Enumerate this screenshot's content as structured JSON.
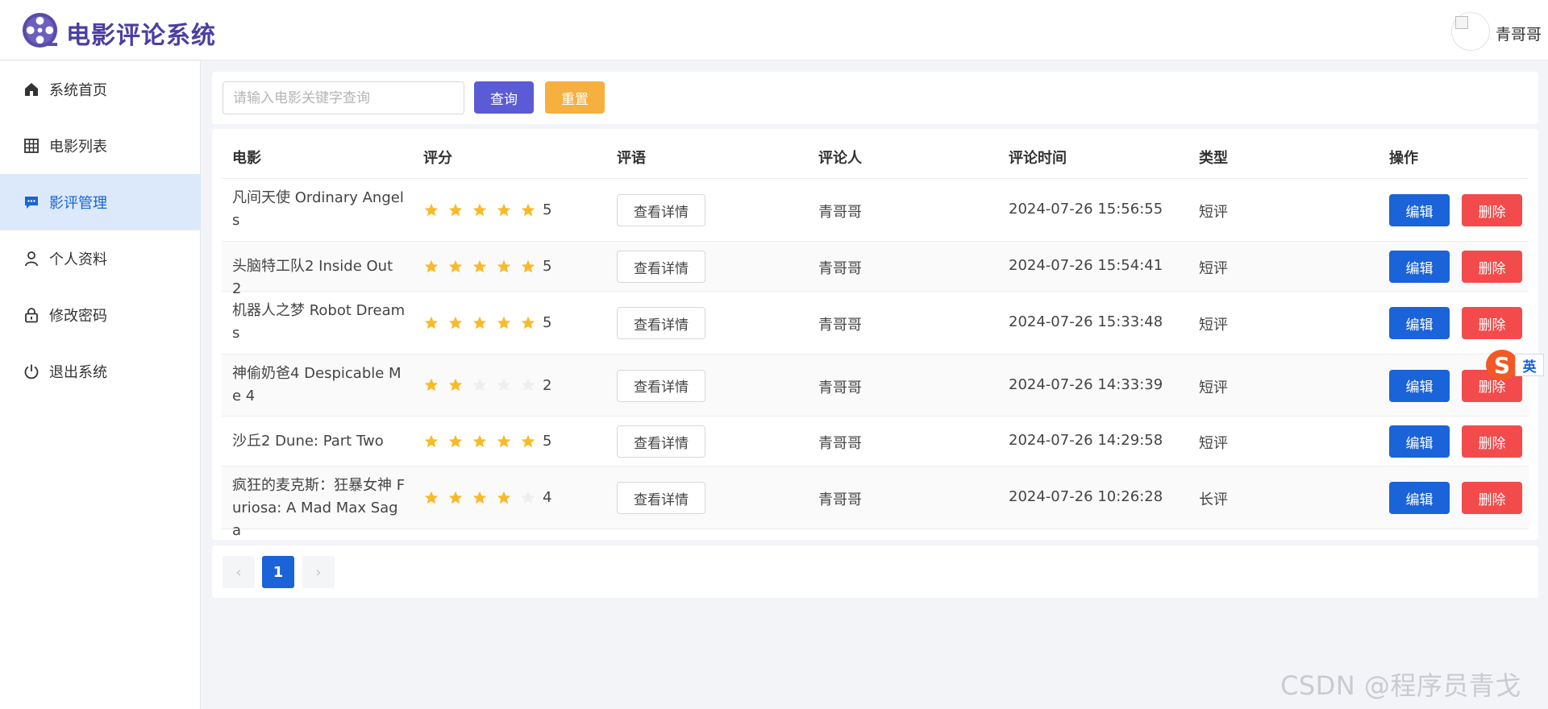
{
  "app": {
    "title": "电影评论系统",
    "user": "青哥哥"
  },
  "sidebar": {
    "items": [
      {
        "label": "系统首页",
        "icon": "home-icon",
        "active": false
      },
      {
        "label": "电影列表",
        "icon": "grid-icon",
        "active": false
      },
      {
        "label": "影评管理",
        "icon": "comment-icon",
        "active": true
      },
      {
        "label": "个人资料",
        "icon": "user-icon",
        "active": false
      },
      {
        "label": "修改密码",
        "icon": "lock-icon",
        "active": false
      },
      {
        "label": "退出系统",
        "icon": "power-icon",
        "active": false
      }
    ]
  },
  "search": {
    "placeholder": "请输入电影关键字查询",
    "value": "",
    "query_label": "查询",
    "reset_label": "重置"
  },
  "table": {
    "headers": {
      "movie": "电影",
      "rating": "评分",
      "comment": "评语",
      "reviewer": "评论人",
      "time": "评论时间",
      "type": "类型",
      "actions": "操作"
    },
    "detail_label": "查看详情",
    "edit_label": "编辑",
    "delete_label": "删除",
    "rows": [
      {
        "movie": "凡间天使 Ordinary Angels",
        "rating": 5,
        "score": "5",
        "reviewer": "青哥哥",
        "time": "2024-07-26 15:56:55",
        "type": "短评"
      },
      {
        "movie": "头脑特工队2 Inside Out 2",
        "rating": 5,
        "score": "5",
        "reviewer": "青哥哥",
        "time": "2024-07-26 15:54:41",
        "type": "短评"
      },
      {
        "movie": "机器人之梦 Robot Dreams",
        "rating": 5,
        "score": "5",
        "reviewer": "青哥哥",
        "time": "2024-07-26 15:33:48",
        "type": "短评"
      },
      {
        "movie": "神偷奶爸4 Despicable Me 4",
        "rating": 2,
        "score": "2",
        "reviewer": "青哥哥",
        "time": "2024-07-26 14:33:39",
        "type": "短评"
      },
      {
        "movie": "沙丘2 Dune: Part Two",
        "rating": 5,
        "score": "5",
        "reviewer": "青哥哥",
        "time": "2024-07-26 14:29:58",
        "type": "短评"
      },
      {
        "movie": "疯狂的麦克斯：狂暴女神 Furiosa: A Mad Max Saga",
        "rating": 4,
        "score": "4",
        "reviewer": "青哥哥",
        "time": "2024-07-26 10:26:28",
        "type": "长评"
      }
    ]
  },
  "pagination": {
    "prev": "‹",
    "current": "1",
    "next": "›"
  },
  "ime": {
    "logo": "S",
    "mode": "英"
  },
  "watermark": "CSDN @程序员青戈",
  "colors": {
    "primary": "#1a63d8",
    "brand": "#4a3fa0",
    "danger": "#f34b4b",
    "warning": "#f6b040",
    "query": "#5b5bd6",
    "star": "#f7ba2a"
  }
}
